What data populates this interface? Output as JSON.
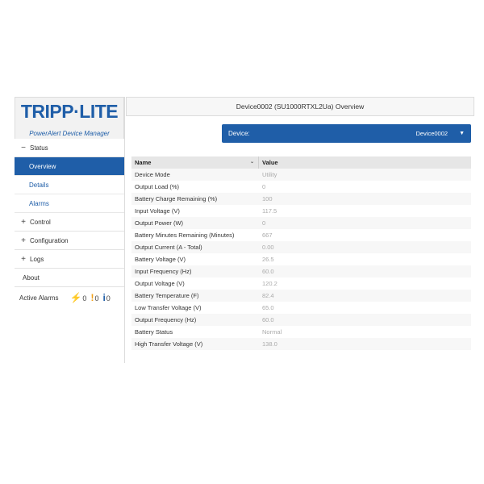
{
  "logo": {
    "brand": "TRIPP·LITE",
    "subtitle": "PowerAlert Device Manager"
  },
  "sidebar": {
    "status": {
      "symbol": "−",
      "label": "Status"
    },
    "status_items": [
      {
        "label": "Overview"
      },
      {
        "label": "Details"
      },
      {
        "label": "Alarms"
      }
    ],
    "control": {
      "symbol": "+",
      "label": "Control"
    },
    "configuration": {
      "symbol": "+",
      "label": "Configuration"
    },
    "logs": {
      "symbol": "+",
      "label": "Logs"
    },
    "about": {
      "label": "About"
    },
    "active_alarms": {
      "label": "Active Alarms",
      "critical": {
        "icon": "⚡",
        "count": "0"
      },
      "warning": {
        "icon": "!",
        "count": "0"
      },
      "info": {
        "icon": "i",
        "count": "0"
      }
    }
  },
  "main": {
    "title": "Device0002 (SU1000RTXL2Ua) Overview",
    "device_selector": {
      "label": "Device:",
      "value": "Device0002",
      "caret": "▼"
    },
    "table": {
      "headers": {
        "name": "Name",
        "value": "Value",
        "sort_icon": "⌄"
      },
      "rows": [
        {
          "name": "Device Mode",
          "value": "Utility"
        },
        {
          "name": "Output Load (%)",
          "value": "0"
        },
        {
          "name": "Battery Charge Remaining (%)",
          "value": "100"
        },
        {
          "name": "Input Voltage (V)",
          "value": "117.5"
        },
        {
          "name": "Output Power (W)",
          "value": "0"
        },
        {
          "name": "Battery Minutes Remaining (Minutes)",
          "value": "667"
        },
        {
          "name": "Output Current (A - Total)",
          "value": "0.00"
        },
        {
          "name": "Battery Voltage (V)",
          "value": "26.5"
        },
        {
          "name": "Input Frequency (Hz)",
          "value": "60.0"
        },
        {
          "name": "Output Voltage (V)",
          "value": "120.2"
        },
        {
          "name": "Battery Temperature (F)",
          "value": "82.4"
        },
        {
          "name": "Low Transfer Voltage (V)",
          "value": "65.0"
        },
        {
          "name": "Output Frequency (Hz)",
          "value": "60.0"
        },
        {
          "name": "Battery Status",
          "value": "Normal"
        },
        {
          "name": "High Transfer Voltage (V)",
          "value": "138.0"
        }
      ]
    }
  },
  "colors": {
    "accent": "#1f5ea8",
    "critical": "#e03a1e",
    "warning": "#f0a019"
  }
}
